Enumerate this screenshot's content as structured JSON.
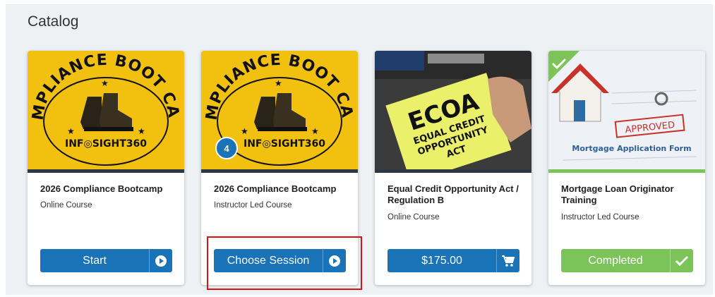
{
  "page": {
    "title": "Catalog"
  },
  "colors": {
    "primary_blue": "#1a73b7",
    "completed_green": "#7cc35a",
    "bootcamp_yellow": "#f2c10f",
    "highlight_red": "#d8111b"
  },
  "cards": [
    {
      "title": "2026 Compliance Bootcamp",
      "type": "Online Course",
      "image_text": {
        "arc": "COMPLIANCE BOOT CAMP",
        "brand_left": "INF",
        "brand_right": "SIGHT360"
      },
      "button": {
        "label": "Start",
        "icon": "play-circle-icon"
      }
    },
    {
      "title": "2026 Compliance Bootcamp",
      "type": "Instructor Led Course",
      "badge": "4",
      "image_text": {
        "arc": "COMPLIANCE BOOT CAMP",
        "brand_left": "INF",
        "brand_right": "SIGHT360"
      },
      "button": {
        "label": "Choose Session",
        "icon": "play-circle-icon"
      }
    },
    {
      "title": "Equal Credit Opportunity Act / Regulation B",
      "type": "Online Course",
      "image_text": {
        "line1": "ECOA",
        "line2": "EQUAL CREDIT",
        "line3": "OPPORTUNITY",
        "line4": "ACT"
      },
      "button": {
        "label": "$175.00",
        "icon": "cart-icon"
      }
    },
    {
      "title": "Mortgage Loan Originator Training",
      "type": "Instructor Led Course",
      "completed": true,
      "image_text": {
        "stamp": "APPROVED",
        "form": "Mortgage Application Form"
      },
      "button": {
        "label": "Completed",
        "icon": "checkmark-icon"
      }
    }
  ]
}
